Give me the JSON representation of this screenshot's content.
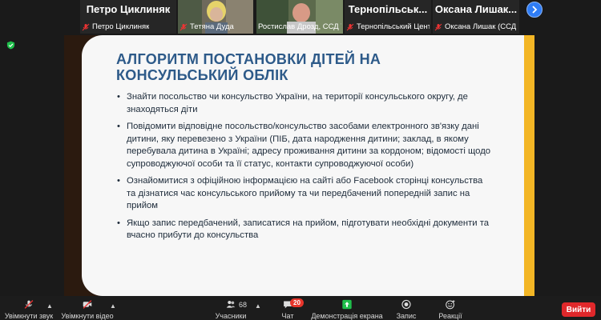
{
  "gallery": {
    "tiles": [
      {
        "big_name": "Петро Циклиняк",
        "caption": "Петро Циклиняк"
      },
      {
        "big_name": "",
        "caption": "Тетяна Дуда"
      },
      {
        "big_name": "",
        "caption": "Ростислав Дрозд, ССД Т..."
      },
      {
        "big_name": "Тернопільськ...",
        "caption": "Тернопільський Цент..."
      },
      {
        "big_name": "Оксана Лишак...",
        "caption": "Оксана Лишак (ССД ..."
      }
    ]
  },
  "slide": {
    "title": "АЛГОРИТМ ПОСТАНОВКИ ДІТЕЙ НА КОНСУЛЬСЬКИЙ ОБЛІК",
    "bullets": [
      "Знайти посольство чи консульство України, на території консульського округу, де знаходяться діти",
      "Повідомити відповідне посольство/консульство засобами електронного зв'язку дані дитини, яку перевезено з України (ПІБ, дата народження дитини; заклад, в якому перебувала дитина в Україні; адресу проживання дитини за кордоном; відомості щодо супроводжуючої особи та її статус, контакти супроводжуючої особи)",
      "Ознайомитися з офіційною інформацією на сайті або Facebook сторінці консульства та дізнатися час консульського прийому та чи передбачений попередній запис на прийом",
      "Якщо запис передбачений, записатися на прийом, підготувати необхідні документи та вчасно прибути до консульства"
    ]
  },
  "toolbar": {
    "audio_label": "Увімкнути звук",
    "video_label": "Увімкнути відео",
    "participants_label": "Учасники",
    "participants_count": "68",
    "chat_label": "Чат",
    "chat_badge": "20",
    "share_label": "Демонстрація екрана",
    "record_label": "Запис",
    "reactions_label": "Реакції",
    "leave_label": "Вийти"
  },
  "colors": {
    "accent_blue": "#2d5a89",
    "slide_yellow": "#f3b625",
    "slide_brown": "#2b1a0f",
    "leave_red": "#e0282b",
    "share_green": "#1fbf4b"
  }
}
